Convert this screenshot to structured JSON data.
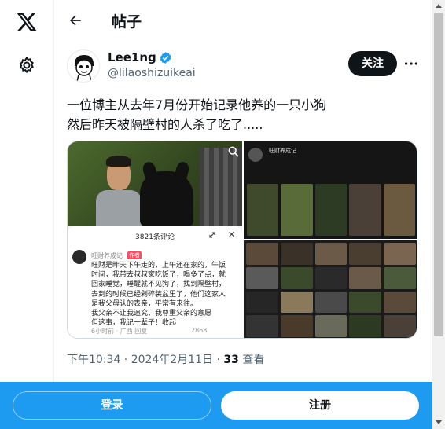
{
  "header": {
    "title": "帖子"
  },
  "author": {
    "name": "Lee1ng",
    "handle": "@lilaoshizuikeai",
    "follow_label": "关注"
  },
  "tweet": {
    "lines": [
      "一位博主从去年7月份开始记录他养的一只小狗",
      "然后昨天被隔壁村的人杀了吃了....."
    ]
  },
  "media": {
    "comments": {
      "count_title": "3821条评论",
      "user": "旺财养成记",
      "tag": "作者",
      "body": [
        "旺财是昨天下午走的，上午还在家的，午饭",
        "时间，我带去叔叔家吃饭了，喝多了点，就",
        "回家睡觉，睡醒就不见狗了，找到隔壁村，",
        "去到的时候已经剁碎装盆里了，他们这家人",
        "是我父母认的表亲，平常有来往。",
        "我父亲不让我追究，我尊重父亲的意愿",
        "但这事，我记一辈子！收起"
      ],
      "meta": "6小时前 · 广西   回复",
      "likes": "2868"
    },
    "profile_name": "旺财养成记"
  },
  "timestamp": {
    "time": "下午10:34 · 2024年2月11日 · ",
    "views_count": "33",
    "views_label": " 查看"
  },
  "bottom_bar": {
    "login_label": "登录",
    "signup_label": "注册"
  },
  "icons": [
    "x-logo-icon",
    "gear-icon",
    "back-arrow-icon",
    "verified-icon",
    "more-icon",
    "zoom-icon",
    "expand-icon",
    "close-icon"
  ],
  "colors": {
    "accent": "#1d9bf0",
    "text": "#0f1419",
    "secondary": "#536471"
  }
}
